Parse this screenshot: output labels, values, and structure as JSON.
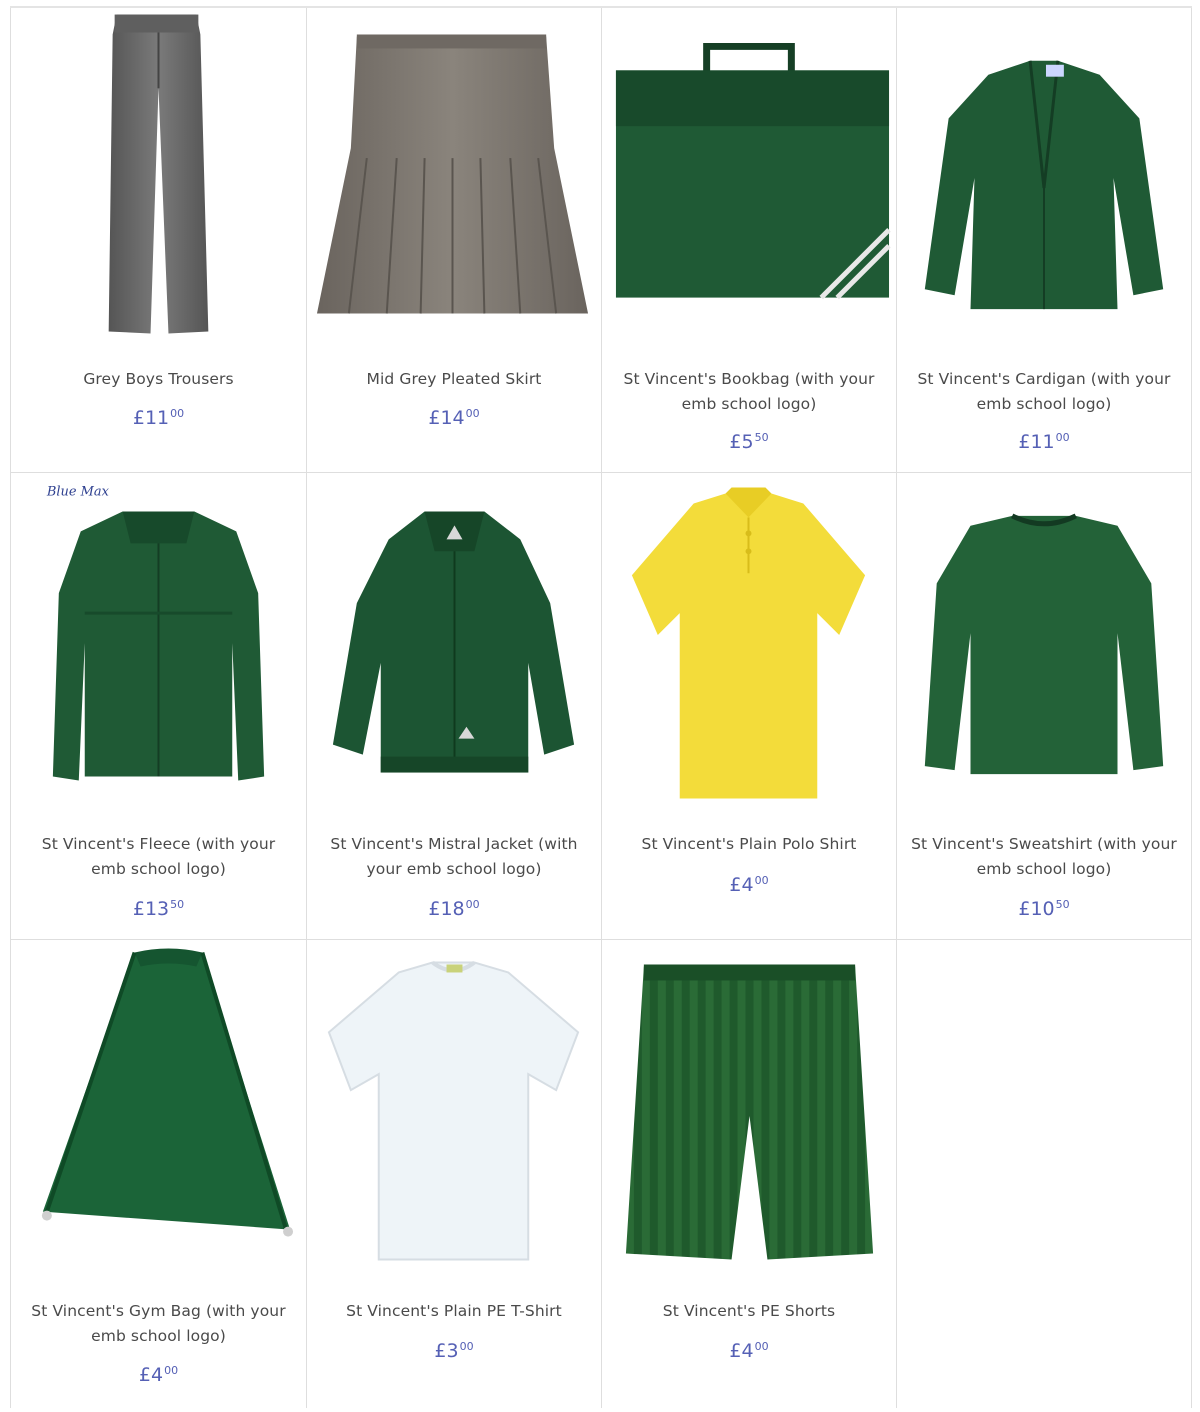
{
  "currency_symbol": "£",
  "products": [
    {
      "name": "Grey Boys Trousers",
      "price_major": "11",
      "price_minor": "00",
      "image_icon": "trousers-icon"
    },
    {
      "name": "Mid Grey Pleated Skirt",
      "price_major": "14",
      "price_minor": "00",
      "image_icon": "skirt-icon"
    },
    {
      "name": "St Vincent's Bookbag (with your emb school logo)",
      "price_major": "5",
      "price_minor": "50",
      "image_icon": "bookbag-icon"
    },
    {
      "name": "St Vincent's Cardigan (with your emb school logo)",
      "price_major": "11",
      "price_minor": "00",
      "image_icon": "cardigan-icon"
    },
    {
      "name": "St Vincent's Fleece (with your emb school logo)",
      "price_major": "13",
      "price_minor": "50",
      "image_icon": "fleece-icon",
      "image_brand_text": "Blue Max"
    },
    {
      "name": "St Vincent's Mistral Jacket (with your emb school logo)",
      "price_major": "18",
      "price_minor": "00",
      "image_icon": "jacket-icon"
    },
    {
      "name": "St Vincent's Plain Polo Shirt",
      "price_major": "4",
      "price_minor": "00",
      "image_icon": "polo-shirt-icon"
    },
    {
      "name": "St Vincent's Sweatshirt (with your emb school logo)",
      "price_major": "10",
      "price_minor": "50",
      "image_icon": "sweatshirt-icon"
    },
    {
      "name": "St Vincent's Gym Bag (with your emb school logo)",
      "price_major": "4",
      "price_minor": "00",
      "image_icon": "gym-bag-icon"
    },
    {
      "name": "St Vincent's Plain PE T-Shirt",
      "price_major": "3",
      "price_minor": "00",
      "image_icon": "tshirt-icon"
    },
    {
      "name": "St Vincent's PE Shorts",
      "price_major": "4",
      "price_minor": "00",
      "image_icon": "shorts-icon"
    }
  ],
  "colors": {
    "price": "#5560b5",
    "bottle_green": "#1f5a35",
    "grey_trousers": "#6b6b6b",
    "grey_skirt": "#7d7770",
    "yellow_polo": "#f3dc3a",
    "white_tshirt": "#eef4f8"
  }
}
